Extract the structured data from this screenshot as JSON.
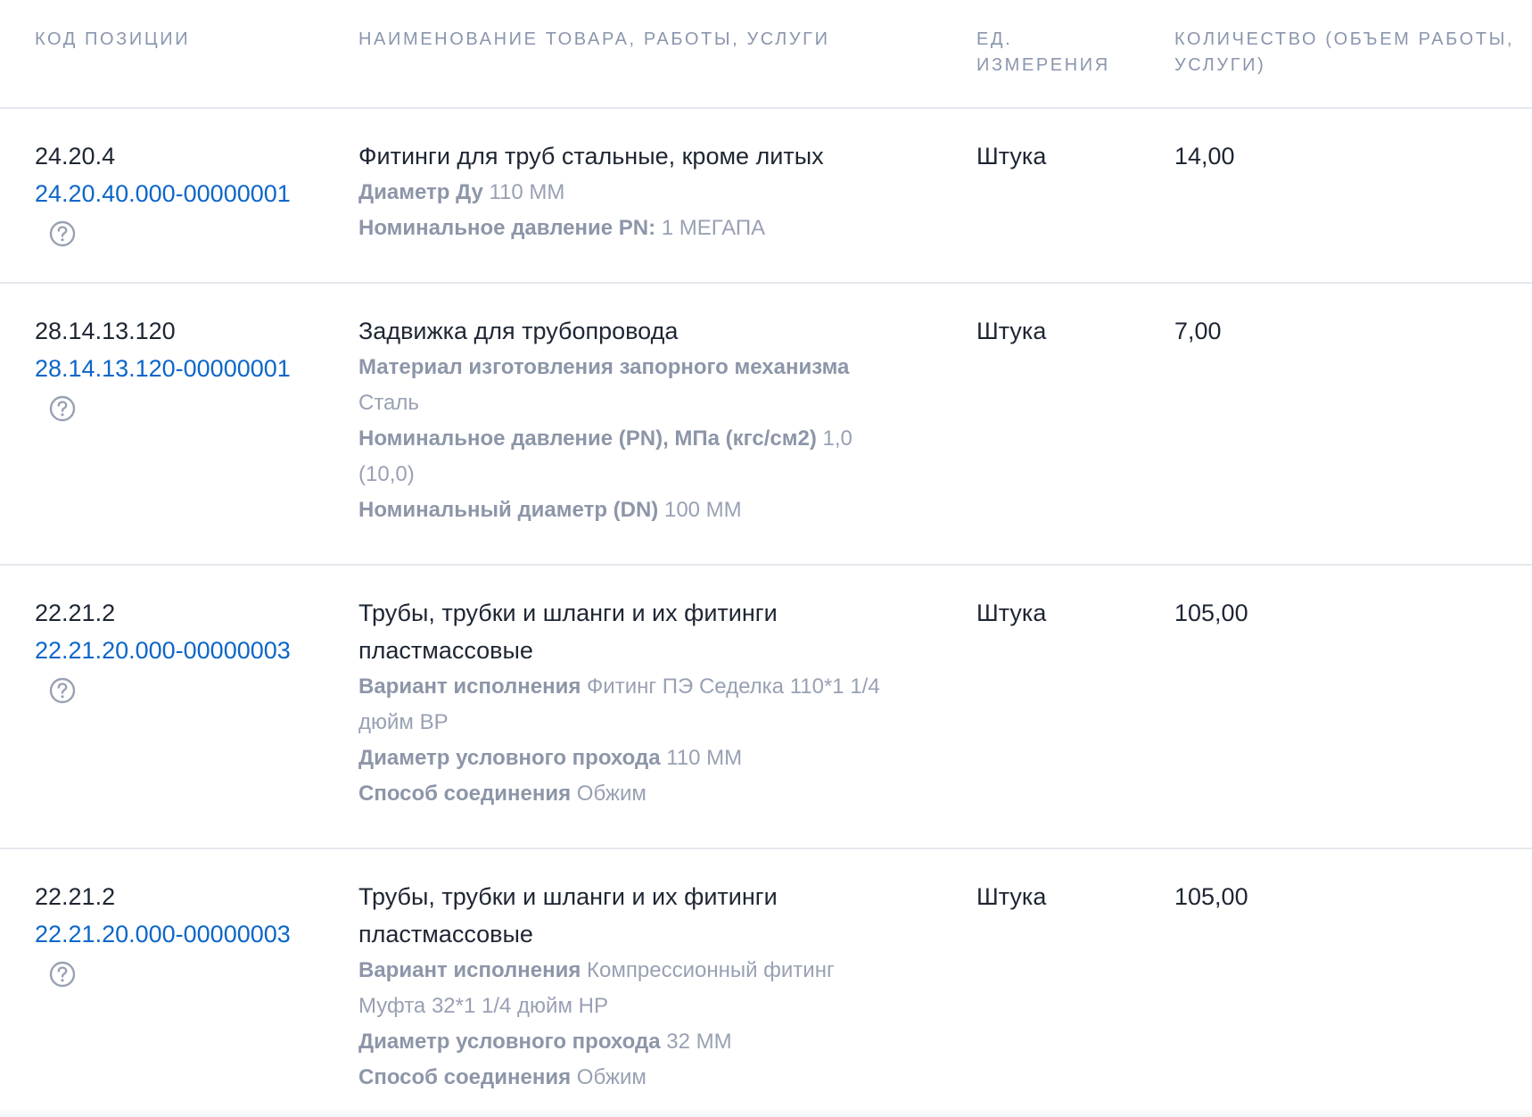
{
  "table": {
    "headers": {
      "code": "КОД ПОЗИЦИИ",
      "name": "НАИМЕНОВАНИЕ ТОВАРА, РАБОТЫ, УСЛУГИ",
      "unit_line1": "ЕД.",
      "unit_line2": "ИЗМЕРЕНИЯ",
      "qty_line1": "КОЛИЧЕСТВО (ОБЪЕМ РАБОТЫ,",
      "qty_line2": "УСЛУГИ)"
    },
    "rows": [
      {
        "code": "24.20.4",
        "link": "24.20.40.000-00000001",
        "name_line1": "Фитинги для труб стальные, кроме литых",
        "props": [
          {
            "label": "Диаметр Ду",
            "value": "110 ММ"
          },
          {
            "label": "Номинальное давление PN:",
            "value": "1 МЕГАПА"
          }
        ],
        "unit": "Штука",
        "qty": "14,00"
      },
      {
        "code": "28.14.13.120",
        "link": "28.14.13.120-00000001",
        "name_line1": "Задвижка для трубопровода",
        "props": [
          {
            "label": "Материал изготовления запорного механизма",
            "value_line2": "Сталь"
          },
          {
            "label": "Номинальное давление (PN), МПа (кгс/см2)",
            "value": "1,0",
            "value_line2": "(10,0)"
          },
          {
            "label": "Номинальный диаметр (DN)",
            "value": "100 ММ"
          }
        ],
        "unit": "Штука",
        "qty": "7,00"
      },
      {
        "code": "22.21.2",
        "link": "22.21.20.000-00000003",
        "name_line1": "Трубы, трубки и шланги и их фитинги",
        "name_line2": "пластмассовые",
        "props": [
          {
            "label": "Вариант исполнения",
            "value": "Фитинг ПЭ Седелка 110*1 1/4",
            "value_line2": "дюйм ВР"
          },
          {
            "label": "Диаметр условного прохода",
            "value": "110 ММ"
          },
          {
            "label": "Способ соединения",
            "value": "Обжим"
          }
        ],
        "unit": "Штука",
        "qty": "105,00"
      },
      {
        "code": "22.21.2",
        "link": "22.21.20.000-00000003",
        "name_line1": "Трубы, трубки и шланги и их фитинги",
        "name_line2": "пластмассовые",
        "props": [
          {
            "label": "Вариант исполнения",
            "value": "Компрессионный фитинг",
            "value_line2": "Муфта 32*1 1/4 дюйм НР"
          },
          {
            "label": "Диаметр условного прохода",
            "value": "32 ММ"
          },
          {
            "label": "Способ соединения",
            "value": "Обжим"
          }
        ],
        "unit": "Штука",
        "qty": "105,00"
      }
    ]
  },
  "colors": {
    "header_text": "#8a96ad",
    "body_text": "#1e2633",
    "link": "#0c66c9",
    "prop_text": "#98a1b3",
    "divider": "#e6e8ef"
  },
  "icons": {
    "help": "question-circle-icon"
  }
}
